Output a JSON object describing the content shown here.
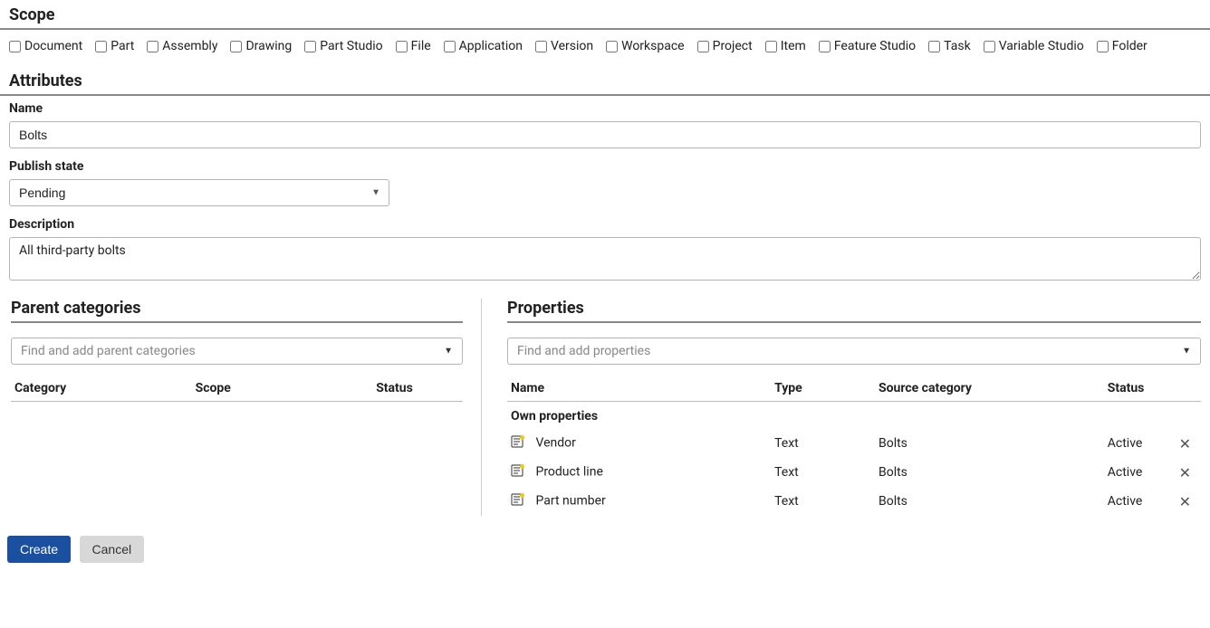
{
  "scope": {
    "heading": "Scope",
    "items": [
      {
        "label": "Document",
        "checked": false
      },
      {
        "label": "Part",
        "checked": false
      },
      {
        "label": "Assembly",
        "checked": false
      },
      {
        "label": "Drawing",
        "checked": false
      },
      {
        "label": "Part Studio",
        "checked": false
      },
      {
        "label": "File",
        "checked": false
      },
      {
        "label": "Application",
        "checked": false
      },
      {
        "label": "Version",
        "checked": false
      },
      {
        "label": "Workspace",
        "checked": false
      },
      {
        "label": "Project",
        "checked": false
      },
      {
        "label": "Item",
        "checked": false
      },
      {
        "label": "Feature Studio",
        "checked": false
      },
      {
        "label": "Task",
        "checked": false
      },
      {
        "label": "Variable Studio",
        "checked": false
      },
      {
        "label": "Folder",
        "checked": false
      }
    ]
  },
  "attributes": {
    "heading": "Attributes",
    "name_label": "Name",
    "name_value": "Bolts",
    "publish_label": "Publish state",
    "publish_value": "Pending",
    "description_label": "Description",
    "description_value": "All third-party bolts"
  },
  "parent": {
    "heading": "Parent categories",
    "combo_placeholder": "Find and add parent categories",
    "columns": {
      "category": "Category",
      "scope": "Scope",
      "status": "Status"
    }
  },
  "properties": {
    "heading": "Properties",
    "combo_placeholder": "Find and add properties",
    "columns": {
      "name": "Name",
      "type": "Type",
      "source": "Source category",
      "status": "Status"
    },
    "own_label": "Own properties",
    "rows": [
      {
        "name": "Vendor",
        "type": "Text",
        "source": "Bolts",
        "status": "Active"
      },
      {
        "name": "Product line",
        "type": "Text",
        "source": "Bolts",
        "status": "Active"
      },
      {
        "name": "Part number",
        "type": "Text",
        "source": "Bolts",
        "status": "Active"
      }
    ]
  },
  "footer": {
    "create": "Create",
    "cancel": "Cancel"
  }
}
